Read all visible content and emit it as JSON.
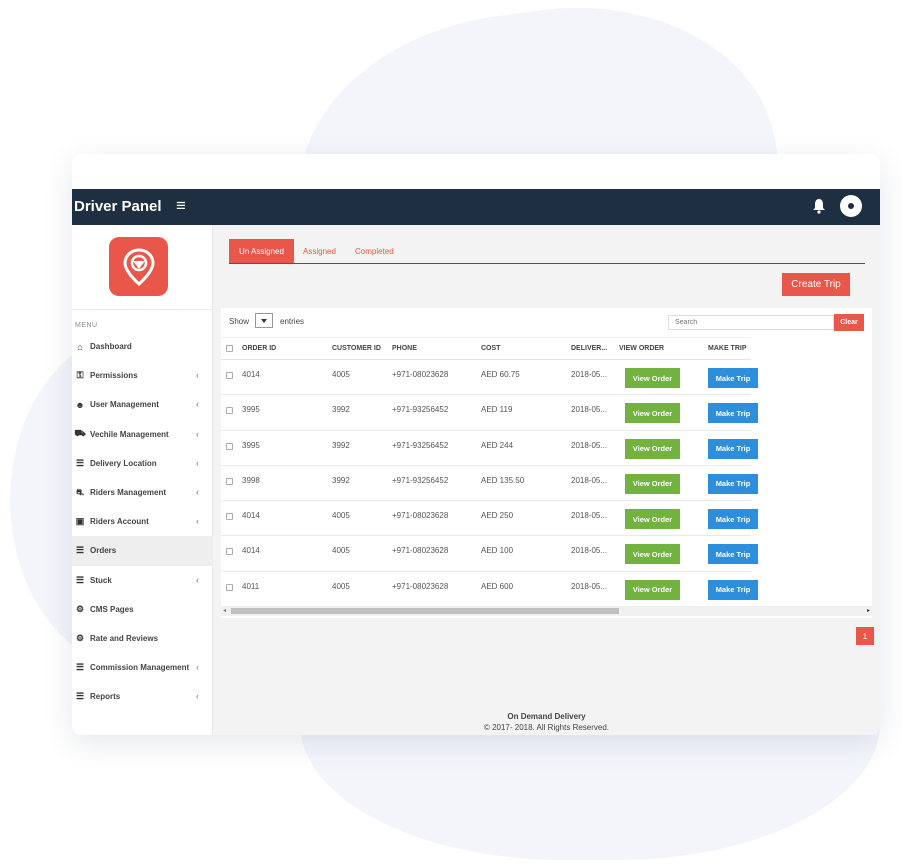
{
  "header": {
    "title": "Driver Panel"
  },
  "sidebar": {
    "menu_title": "MENU",
    "items": [
      {
        "label": "Dashboard",
        "icon": "home-icon",
        "glyph": "⌂",
        "chevron": false,
        "active": false
      },
      {
        "label": "Permissions",
        "icon": "key-icon",
        "glyph": "⚿",
        "chevron": true,
        "active": false
      },
      {
        "label": "User Management",
        "icon": "users-icon",
        "glyph": "☻",
        "chevron": true,
        "active": false
      },
      {
        "label": "Vechile Management",
        "icon": "car-icon",
        "glyph": "⛟",
        "chevron": true,
        "active": false
      },
      {
        "label": "Delivery Location",
        "icon": "list-icon",
        "glyph": "☰",
        "chevron": true,
        "active": false
      },
      {
        "label": "Riders Management",
        "icon": "motorcycle-icon",
        "glyph": "⛐",
        "chevron": true,
        "active": false
      },
      {
        "label": "Riders Account",
        "icon": "id-card-icon",
        "glyph": "▣",
        "chevron": true,
        "active": false
      },
      {
        "label": "Orders",
        "icon": "list-icon",
        "glyph": "☰",
        "chevron": false,
        "active": true
      },
      {
        "label": "Stuck",
        "icon": "list-icon",
        "glyph": "☰",
        "chevron": true,
        "active": false
      },
      {
        "label": "CMS Pages",
        "icon": "gear-icon",
        "glyph": "⚙",
        "chevron": false,
        "active": false
      },
      {
        "label": "Rate and Reviews",
        "icon": "gear-icon",
        "glyph": "⚙",
        "chevron": false,
        "active": false
      },
      {
        "label": "Commission Management",
        "icon": "list-icon",
        "glyph": "☰",
        "chevron": true,
        "active": false
      },
      {
        "label": "Reports",
        "icon": "list-icon",
        "glyph": "☰",
        "chevron": true,
        "active": false
      }
    ]
  },
  "tabs": [
    {
      "label": "Un Assigned",
      "active": true
    },
    {
      "label": "Assigned",
      "active": false
    },
    {
      "label": "Completed",
      "active": false
    }
  ],
  "create_trip_label": "Create Trip",
  "table_controls": {
    "show_label": "Show",
    "entries_label": "entries",
    "search_placeholder": "Search",
    "clear_label": "Clear"
  },
  "table": {
    "columns": [
      "ORDER ID",
      "CUSTOMER ID",
      "PHONE",
      "COST",
      "DELIVER...",
      "VIEW ORDER",
      "MAKE TRIP"
    ],
    "rows": [
      {
        "order_id": "4014",
        "customer_id": "4005",
        "phone": "+971-08023628",
        "cost": "AED 60.75",
        "delivery": "2018-05...",
        "view": "View Order",
        "make": "Make Trip"
      },
      {
        "order_id": "3995",
        "customer_id": "3992",
        "phone": "+971-93256452",
        "cost": "AED 119",
        "delivery": "2018-05...",
        "view": "View Order",
        "make": "Make Trip"
      },
      {
        "order_id": "3995",
        "customer_id": "3992",
        "phone": "+971-93256452",
        "cost": "AED 244",
        "delivery": "2018-05...",
        "view": "View Order",
        "make": "Make Trip"
      },
      {
        "order_id": "3998",
        "customer_id": "3992",
        "phone": "+971-93256452",
        "cost": "AED 135.50",
        "delivery": "2018-05...",
        "view": "View Order",
        "make": "Make Trip"
      },
      {
        "order_id": "4014",
        "customer_id": "4005",
        "phone": "+971-08023628",
        "cost": "AED 250",
        "delivery": "2018-05...",
        "view": "View Order",
        "make": "Make Trip"
      },
      {
        "order_id": "4014",
        "customer_id": "4005",
        "phone": "+971-08023628",
        "cost": "AED 100",
        "delivery": "2018-05...",
        "view": "View Order",
        "make": "Make Trip"
      },
      {
        "order_id": "4011",
        "customer_id": "4005",
        "phone": "+971-08023628",
        "cost": "AED 600",
        "delivery": "2018-05...",
        "view": "View Order",
        "make": "Make Trip"
      }
    ]
  },
  "pagination": {
    "current": "1"
  },
  "footer": {
    "title": "On Demand Delivery",
    "copyright": "© 2017- 2018. All Rights Reserved."
  },
  "colors": {
    "accent": "#e8574a",
    "topbar": "#1d2f41",
    "view_button": "#72b23f",
    "trip_button": "#2d8fdb"
  }
}
